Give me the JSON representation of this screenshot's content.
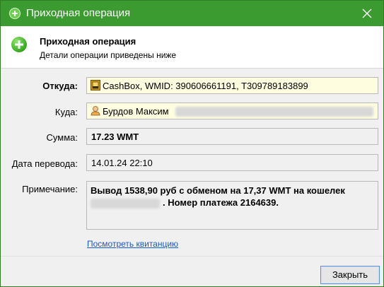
{
  "window": {
    "title": "Приходная операция",
    "accent_color": "#3c9b30"
  },
  "header": {
    "title": "Приходная операция",
    "subtitle": "Детали операции приведены ниже"
  },
  "fields": {
    "from": {
      "label": "Откуда:",
      "value": "CashBox, WMID: 390606661191, T309789183899",
      "icon": "cashbox-icon"
    },
    "to": {
      "label": "Куда:",
      "value": "Бурдов Максим",
      "icon": "user-icon"
    },
    "amount": {
      "label": "Сумма:",
      "value": "17.23 WMT"
    },
    "date": {
      "label": "Дата перевода:",
      "value": "14.01.24 22:10"
    },
    "note": {
      "label": "Примечание:",
      "line1": "Вывод 1538,90 руб с обменом на 17,37 WMT на кошелек",
      "line2": ". Номер платежа 2164639."
    }
  },
  "receipt_link": "Посмотреть квитанцию",
  "close_button": "Закрыть"
}
